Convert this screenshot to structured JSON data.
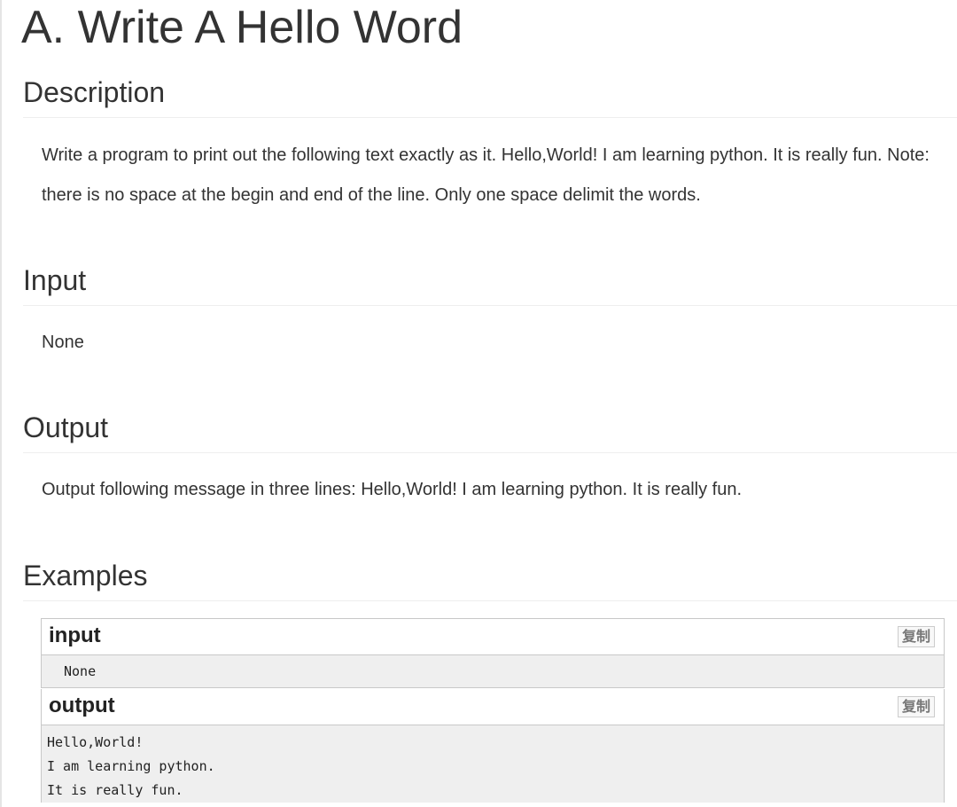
{
  "problem": {
    "title": "A. Write A Hello Word"
  },
  "description": {
    "heading": "Description",
    "text": "Write a program to print out the following text exactly as it. Hello,World! I am learning python. It is really fun. Note: there is no space at the begin and end of the line. Only one space delimit the words."
  },
  "input": {
    "heading": "Input",
    "text": "None"
  },
  "output": {
    "heading": "Output",
    "text": "Output following message in three lines: Hello,World! I am learning python. It is really fun."
  },
  "examples": {
    "heading": "Examples",
    "input_label": "input",
    "input_copy_label": "复制",
    "input_value": "None",
    "output_label": "output",
    "output_copy_label": "复制",
    "output_value": "Hello,World!\nI am learning python.\nIt is really fun."
  }
}
